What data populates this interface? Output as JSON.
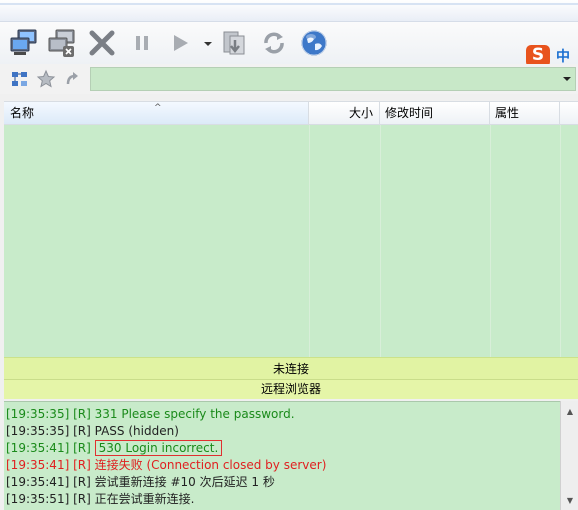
{
  "toolbar": {
    "buttons": [
      {
        "name": "connect-icon"
      },
      {
        "name": "disconnect-icon"
      },
      {
        "name": "stop-icon"
      },
      {
        "name": "pause-icon"
      },
      {
        "name": "play-icon"
      },
      {
        "name": "queue-icon"
      },
      {
        "name": "refresh-icon"
      },
      {
        "name": "globe-icon"
      }
    ]
  },
  "ime": {
    "logo": "S",
    "mode": "中"
  },
  "address": {
    "value": ""
  },
  "columns": {
    "name": "名称",
    "size": "大小",
    "modified": "修改时间",
    "attributes": "属性"
  },
  "status": {
    "connection": "未连接",
    "panel_title": "远程浏览器"
  },
  "log": [
    {
      "time": "[19:35:35]",
      "tag": "[R]",
      "msg": "331 Please specify the password.",
      "color": "green"
    },
    {
      "time": "[19:35:35]",
      "tag": "[R]",
      "msg": "PASS (hidden)",
      "color": "dark"
    },
    {
      "time": "[19:35:41]",
      "tag": "[R]",
      "msg": "530 Login incorrect.",
      "color": "green"
    },
    {
      "time": "[19:35:41]",
      "tag": "[R]",
      "msg": "连接失败 (Connection closed by server)",
      "color": "red"
    },
    {
      "time": "[19:35:41]",
      "tag": "[R]",
      "msg": "尝试重新连接 #10 次后延迟 1 秒",
      "color": "dark"
    },
    {
      "time": "[19:35:51]",
      "tag": "[R]",
      "msg": "正在尝试重新连接.",
      "color": "dark"
    }
  ],
  "colors": {
    "list_bg": "#c8ebca",
    "status_bg": "#e1f3a3",
    "log_green": "#1a8a1a",
    "log_red": "#e02020"
  }
}
